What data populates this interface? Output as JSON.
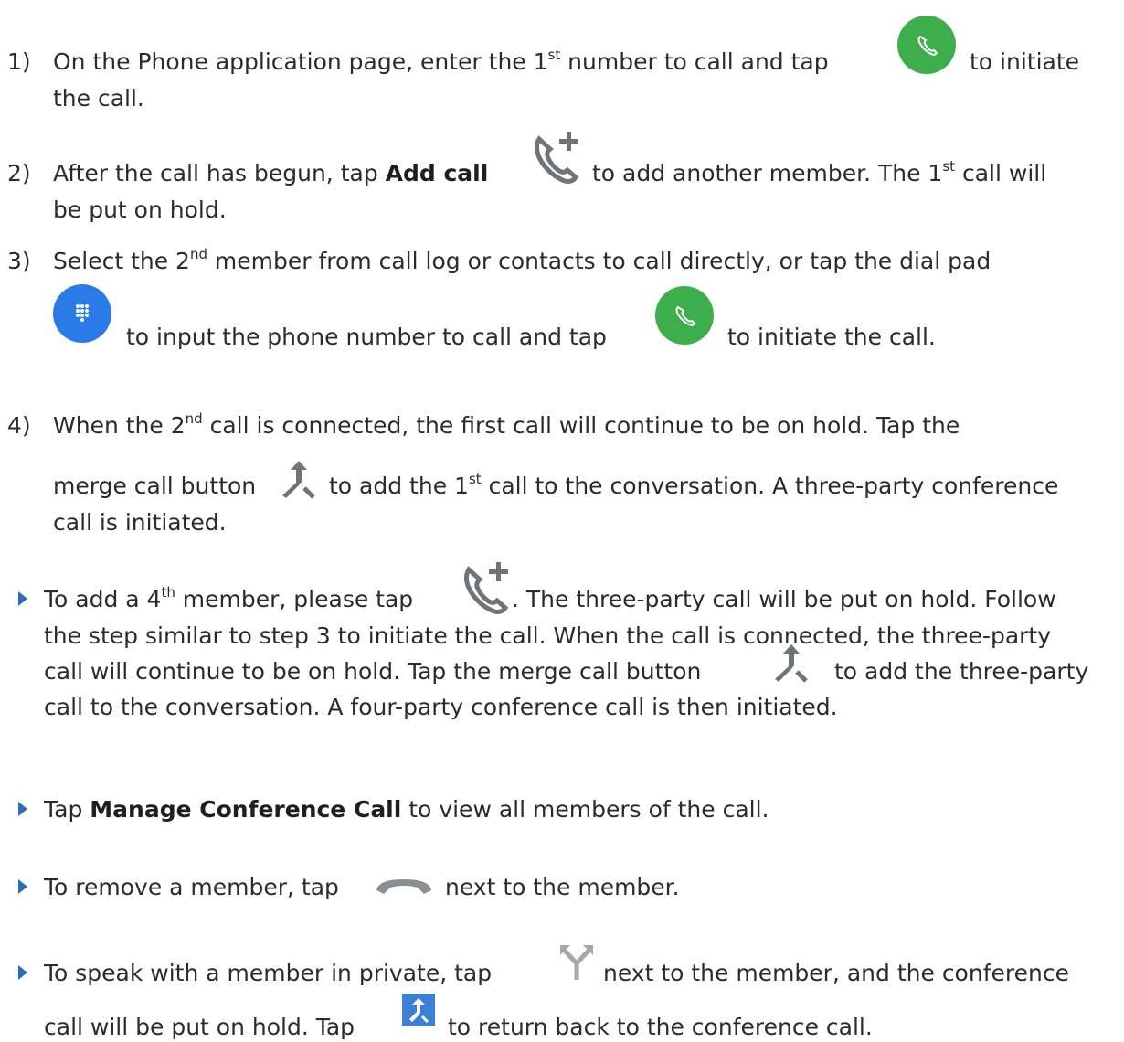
{
  "steps": [
    {
      "number": "1)",
      "l1": {
        "a": "On the Phone application page, enter the 1",
        "sup": "st",
        "b": " number to call and tap",
        "c": "to initiate"
      },
      "l2": "the call."
    },
    {
      "number": "2)",
      "l1": {
        "a": "After the call has begun, tap ",
        "bold": "Add call",
        "b": "to add another member. The 1",
        "sup": "st",
        "c": " call will"
      },
      "l2": "be put on hold."
    },
    {
      "number": "3)",
      "l1": {
        "a": "Select the 2",
        "sup": "nd",
        "b": " member from call log or contacts to call directly, or tap the dial pad"
      },
      "l2": {
        "a": "to input the phone number to call and tap",
        "b": "to initiate the call."
      }
    },
    {
      "number": "4)",
      "l1": {
        "a": "When the 2",
        "sup": "nd",
        "b": " call is connected, the first call will continue to be on hold. Tap the"
      },
      "l2": {
        "a": "merge call button",
        "b": "to add the 1",
        "sup": "st",
        "c": " call to the conversation. A three-party conference"
      },
      "l3": "call is initiated."
    }
  ],
  "bullets": [
    {
      "l1": {
        "a": "To add a 4",
        "sup": "th",
        "b": " member, please tap",
        "c": ". The three-party call will be put on hold. Follow"
      },
      "l2": "the step similar to step 3 to initiate the call. When the call is connected, the three-party",
      "l3": {
        "a": "call will continue to be on hold. Tap the merge call button",
        "b": "to add the three-party"
      },
      "l4": "call to the conversation. A four-party conference call is then initiated."
    },
    {
      "l1": {
        "a": "Tap ",
        "bold": "Manage Conference Call",
        "b": " to view all members of the call."
      }
    },
    {
      "l1": {
        "a": "To remove a member, tap",
        "b": "next to the member."
      }
    },
    {
      "l1": {
        "a": "To speak with a member in private, tap",
        "b": "next to the member, and the conference"
      },
      "l2": {
        "a": "call will be put on hold. Tap",
        "b": "to return back to the conference call."
      }
    }
  ],
  "icons": {
    "call": "phone-green-circle-icon",
    "add_call": "add-call-icon",
    "dialpad": "dialpad-blue-circle-icon",
    "merge": "merge-call-icon",
    "hang_up": "hang-up-icon",
    "split": "split-call-icon",
    "return": "return-merge-blue-icon"
  },
  "colors": {
    "green": "#3dae4c",
    "blue": "#2a7ae8",
    "dark_gray": "#707478",
    "bullet": "#2f6eb5",
    "return_blue": "#3d7fd6"
  }
}
